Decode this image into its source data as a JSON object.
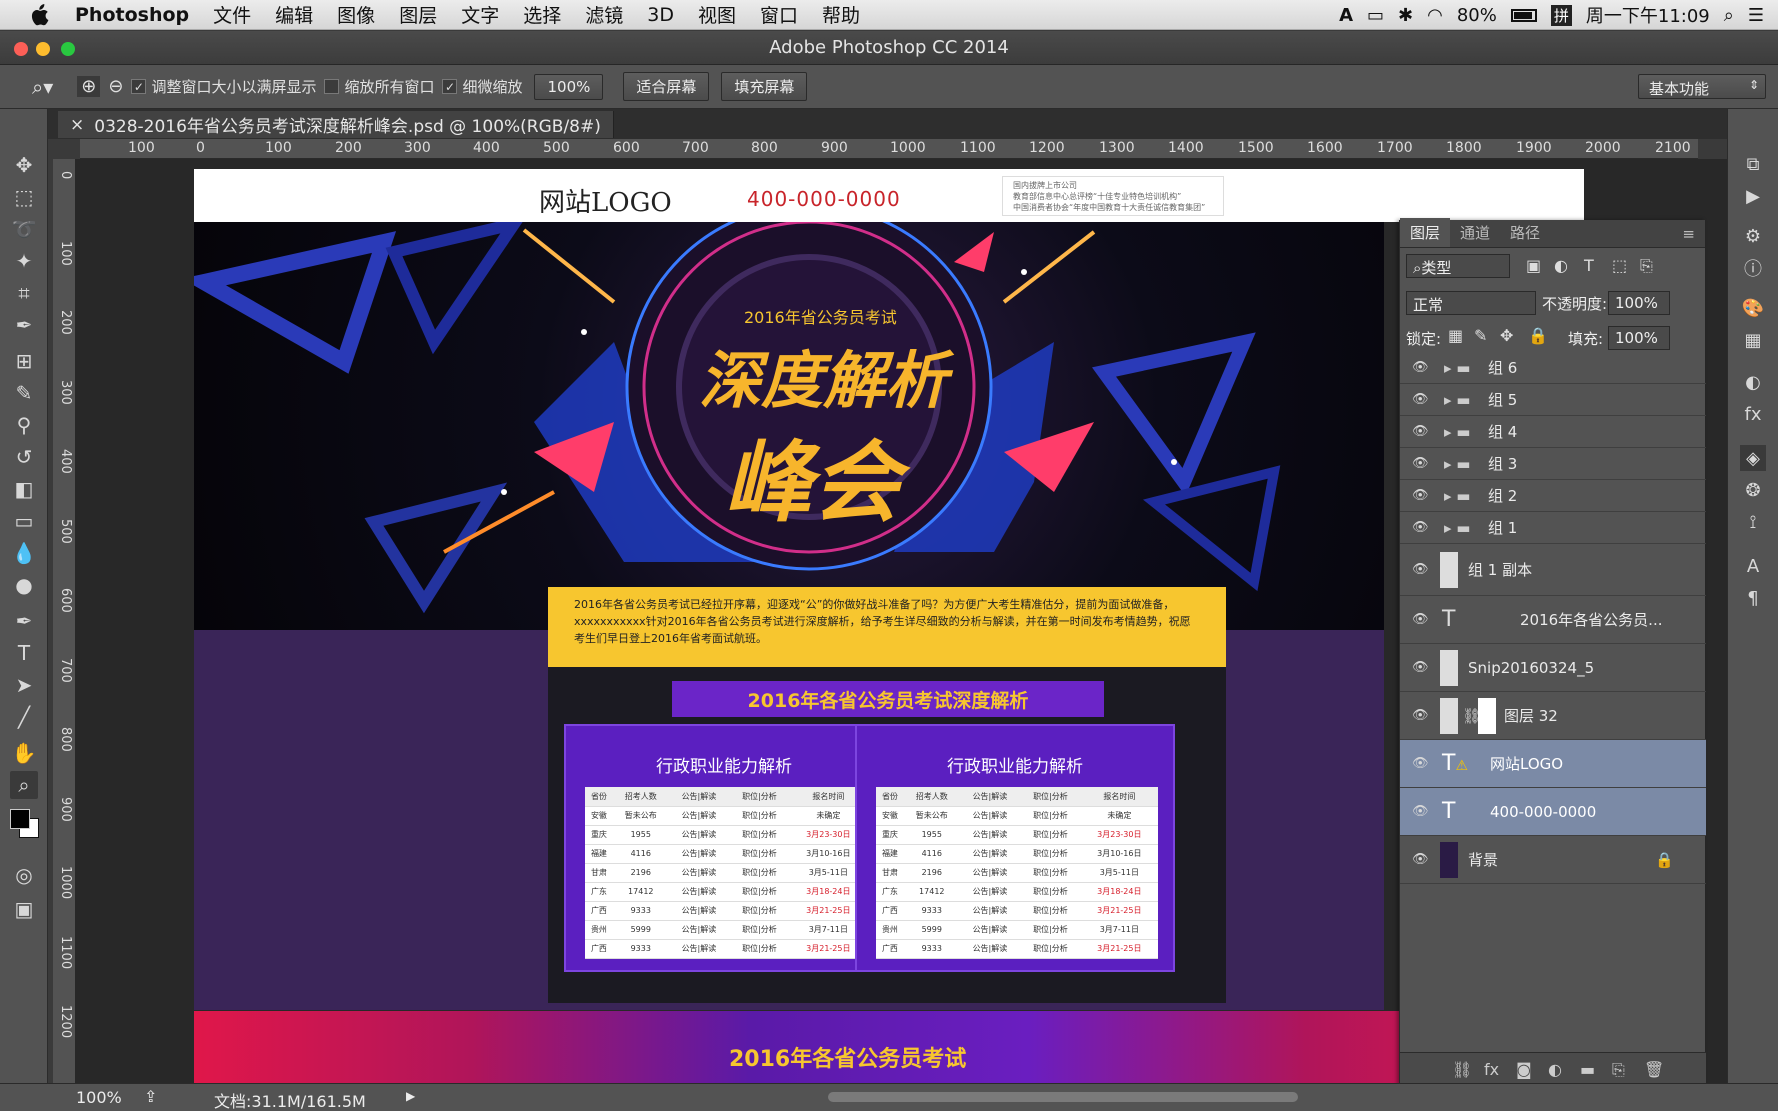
{
  "menubar": {
    "app": "Photoshop",
    "items": [
      "文件",
      "编辑",
      "图像",
      "图层",
      "文字",
      "选择",
      "滤镜",
      "3D",
      "视图",
      "窗口",
      "帮助"
    ],
    "battery": "80%",
    "clock": "周一下午11:09"
  },
  "window": {
    "title": "Adobe Photoshop CC 2014"
  },
  "options": {
    "chk1": "调整窗口大小以满屏显示",
    "chk2": "缩放所有窗口",
    "chk3": "细微缩放",
    "zoom": "100%",
    "fit": "适合屏幕",
    "fill": "填充屏幕",
    "workspace": "基本功能"
  },
  "doc": {
    "tab": "0328-2016年省公务员考试深度解析峰会.psd @ 100%(RGB/8#)",
    "close": "×"
  },
  "ruler": {
    "h": [
      "100",
      "0",
      "100",
      "200",
      "300",
      "400",
      "500",
      "600",
      "700",
      "800",
      "900",
      "1000",
      "1100",
      "1200",
      "1300",
      "1400",
      "1500",
      "1600",
      "1700",
      "1800",
      "1900",
      "2000",
      "2100"
    ],
    "v": [
      "0",
      "100",
      "200",
      "300",
      "400",
      "500",
      "600",
      "700",
      "800",
      "900",
      "1000",
      "1100",
      "1200"
    ]
  },
  "site": {
    "logo": "网站LOGO",
    "phone": "400-000-0000",
    "info1": "国内拔牌上市公司",
    "info2": "教育部信息中心总评榜“十佳专业特色培训机构”",
    "info3": "中国消费者协会“年度中国教育十大责任诚信教育集团”",
    "hero_sub": "2016年省公务员考试",
    "hero_title1": "深度解析",
    "hero_title2": "峰会",
    "intro": "2016年各省公务员考试已经拉开序幕，迎逐戏“公”的你做好战斗准备了吗？为方便广大考生精准估分，提前为面试做准备，xxxxxxxxxxx针对2016年各省公务员考试进行深度解析，给予考生详尽细致的分析与解读，并在第一时间发布考情趋势，祝愿考生们早日登上2016年省考面试航班。",
    "section": "2016年各省公务员考试深度解析",
    "card_title": "行政职业能力解析",
    "band": "2016年各省公务员考试"
  },
  "table": {
    "head": [
      "省份",
      "招考人数",
      "公告|解读",
      "职位|分析",
      "报名时间"
    ],
    "rows": [
      [
        "安徽",
        "暂未公布",
        "公告|解读",
        "职位|分析",
        "未确定"
      ],
      [
        "重庆",
        "1955",
        "公告|解读",
        "职位|分析",
        "3月23-30日"
      ],
      [
        "福建",
        "4116",
        "公告|解读",
        "职位|分析",
        "3月10-16日"
      ],
      [
        "甘肃",
        "2196",
        "公告|解读",
        "职位|分析",
        "3月5-11日"
      ],
      [
        "广东",
        "17412",
        "公告|解读",
        "职位|分析",
        "3月18-24日"
      ],
      [
        "广西",
        "9333",
        "公告|解读",
        "职位|分析",
        "3月21-25日"
      ],
      [
        "贵州",
        "5999",
        "公告|解读",
        "职位|分析",
        "3月7-11日"
      ],
      [
        "广西",
        "9333",
        "公告|解读",
        "职位|分析",
        "3月21-25日"
      ]
    ],
    "red_rows": [
      1,
      4,
      5,
      7
    ]
  },
  "layers": {
    "tabs": [
      "图层",
      "通道",
      "路径"
    ],
    "kind": "类型",
    "blend": "正常",
    "opacity_label": "不透明度:",
    "opacity": "100%",
    "lock_label": "锁定:",
    "fill_label": "填充:",
    "fill": "100%",
    "items": [
      "组 6",
      "组 5",
      "组 4",
      "组 3",
      "组 2",
      "组 1",
      "组 1 副本",
      "2016年各省公务员...",
      "Snip20160324_5",
      "图层 32",
      "网站LOGO",
      "400-000-0000",
      "背景"
    ]
  },
  "status": {
    "zoom": "100%",
    "doc": "文档:31.1M/161.5M"
  }
}
